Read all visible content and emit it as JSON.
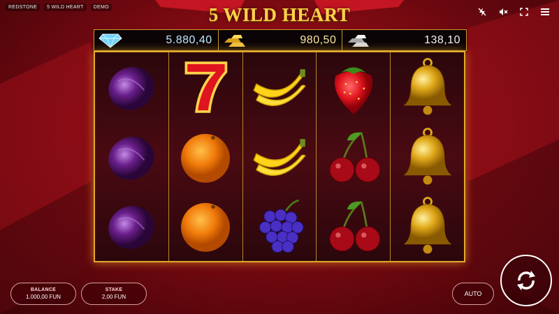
{
  "top_labels": [
    "REDSTONE",
    "5 WILD HEART",
    "DEMO"
  ],
  "title": "5 WILD HEART",
  "icons": {
    "flash": "flash-off-icon",
    "sound": "mute-icon",
    "fullscreen": "fullscreen-icon",
    "menu": "menu-icon"
  },
  "jackpots": [
    {
      "name": "diamond",
      "value": "5.880,40",
      "icon": "diamond-icon"
    },
    {
      "name": "gold",
      "value": "980,50",
      "icon": "gold-bars-icon"
    },
    {
      "name": "silver",
      "value": "138,10",
      "icon": "silver-bars-icon"
    }
  ],
  "reels": [
    [
      "plum",
      "plum",
      "plum"
    ],
    [
      "seven",
      "orange",
      "orange"
    ],
    [
      "banana",
      "banana",
      "grapes"
    ],
    [
      "strawberry",
      "cherry",
      "cherry"
    ],
    [
      "bell",
      "bell",
      "bell"
    ]
  ],
  "balance": {
    "label": "BALANCE",
    "value": "1.000,00 FUN"
  },
  "stake": {
    "label": "STAKE",
    "value": "2,00 FUN"
  },
  "auto_label": "AUTO",
  "colors": {
    "accent_gold": "#e0a82e",
    "background_red": "#8a0c14"
  }
}
